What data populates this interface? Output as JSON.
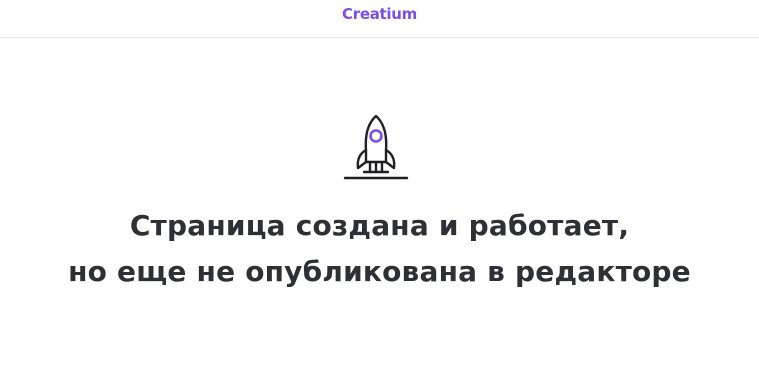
{
  "header": {
    "brand": "Creatium"
  },
  "main": {
    "icon": "rocket-icon",
    "headline_line1": "Страница создана и работает,",
    "headline_line2": "но еще не опубликована в редакторе"
  },
  "colors": {
    "brand": "#7b4fe6",
    "text": "#2f2f36",
    "icon_stroke": "#1f1f24",
    "icon_accent": "#7b4fe6",
    "divider": "#ececf0"
  }
}
